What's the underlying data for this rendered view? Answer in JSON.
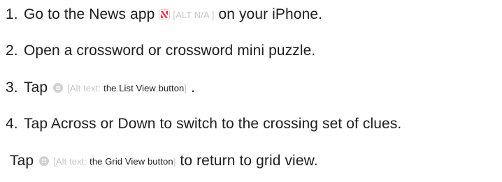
{
  "steps": [
    {
      "num": "1.",
      "pre": "Go to the News app",
      "icon": "news-app-icon",
      "alt_open": "[ALT N/A ]",
      "post": "on your iPhone."
    },
    {
      "num": "2.",
      "text": "Open a crossword or crossword mini puzzle."
    },
    {
      "num": "3.",
      "pre": "Tap",
      "icon": "list-view-icon",
      "alt_label": "[Alt text:",
      "alt_desc": "the List View button",
      "alt_close": "]",
      "post": "."
    },
    {
      "num": "4.",
      "text": "Tap Across or Down to switch to the crossing set of clues."
    }
  ],
  "final": {
    "pre": "Tap",
    "icon": "grid-view-icon",
    "alt_label": "[Alt text:",
    "alt_desc": "the Grid View button",
    "alt_close": "]",
    "post": "to return to grid view."
  },
  "colors": {
    "text": "#1d1d1f",
    "alt_muted": "#c7c7cc",
    "news_red": "#fa2d48"
  }
}
